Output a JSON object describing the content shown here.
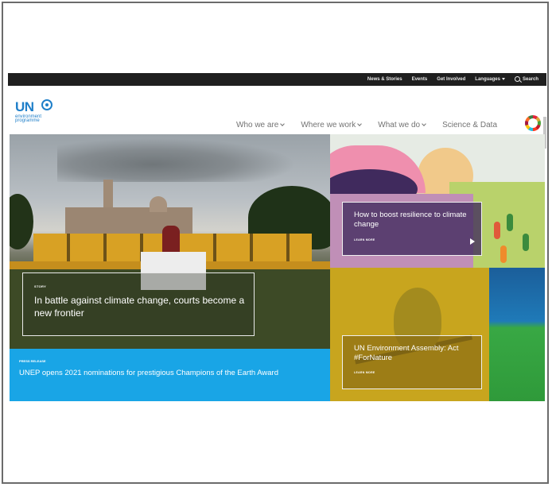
{
  "utility_bar": {
    "news": "News & Stories",
    "events": "Events",
    "get_involved": "Get Involved",
    "languages": "Languages",
    "search": "Search"
  },
  "logo": {
    "un": "UN",
    "line1": "environment",
    "line2": "programme"
  },
  "nav": {
    "who": "Who we are",
    "where": "Where we work",
    "what": "What we do",
    "science": "Science & Data"
  },
  "hero": {
    "tag": "STORY",
    "headline": "In battle against climate change, courts become a new frontier"
  },
  "press": {
    "tag": "PRESS RELEASE",
    "headline": "UNEP opens 2021 nominations for prestigious Champions of the Earth Award"
  },
  "card_resilience": {
    "title": "How to boost resilience to climate change",
    "learn": "LEARN MORE"
  },
  "card_assembly": {
    "title": "UN Environment Assembly: Act #ForNature",
    "learn": "LEARN MORE"
  },
  "colors": {
    "un_blue": "#1f7fc9",
    "press_blue": "#19a5e6",
    "topbar": "#1f1f1f"
  }
}
